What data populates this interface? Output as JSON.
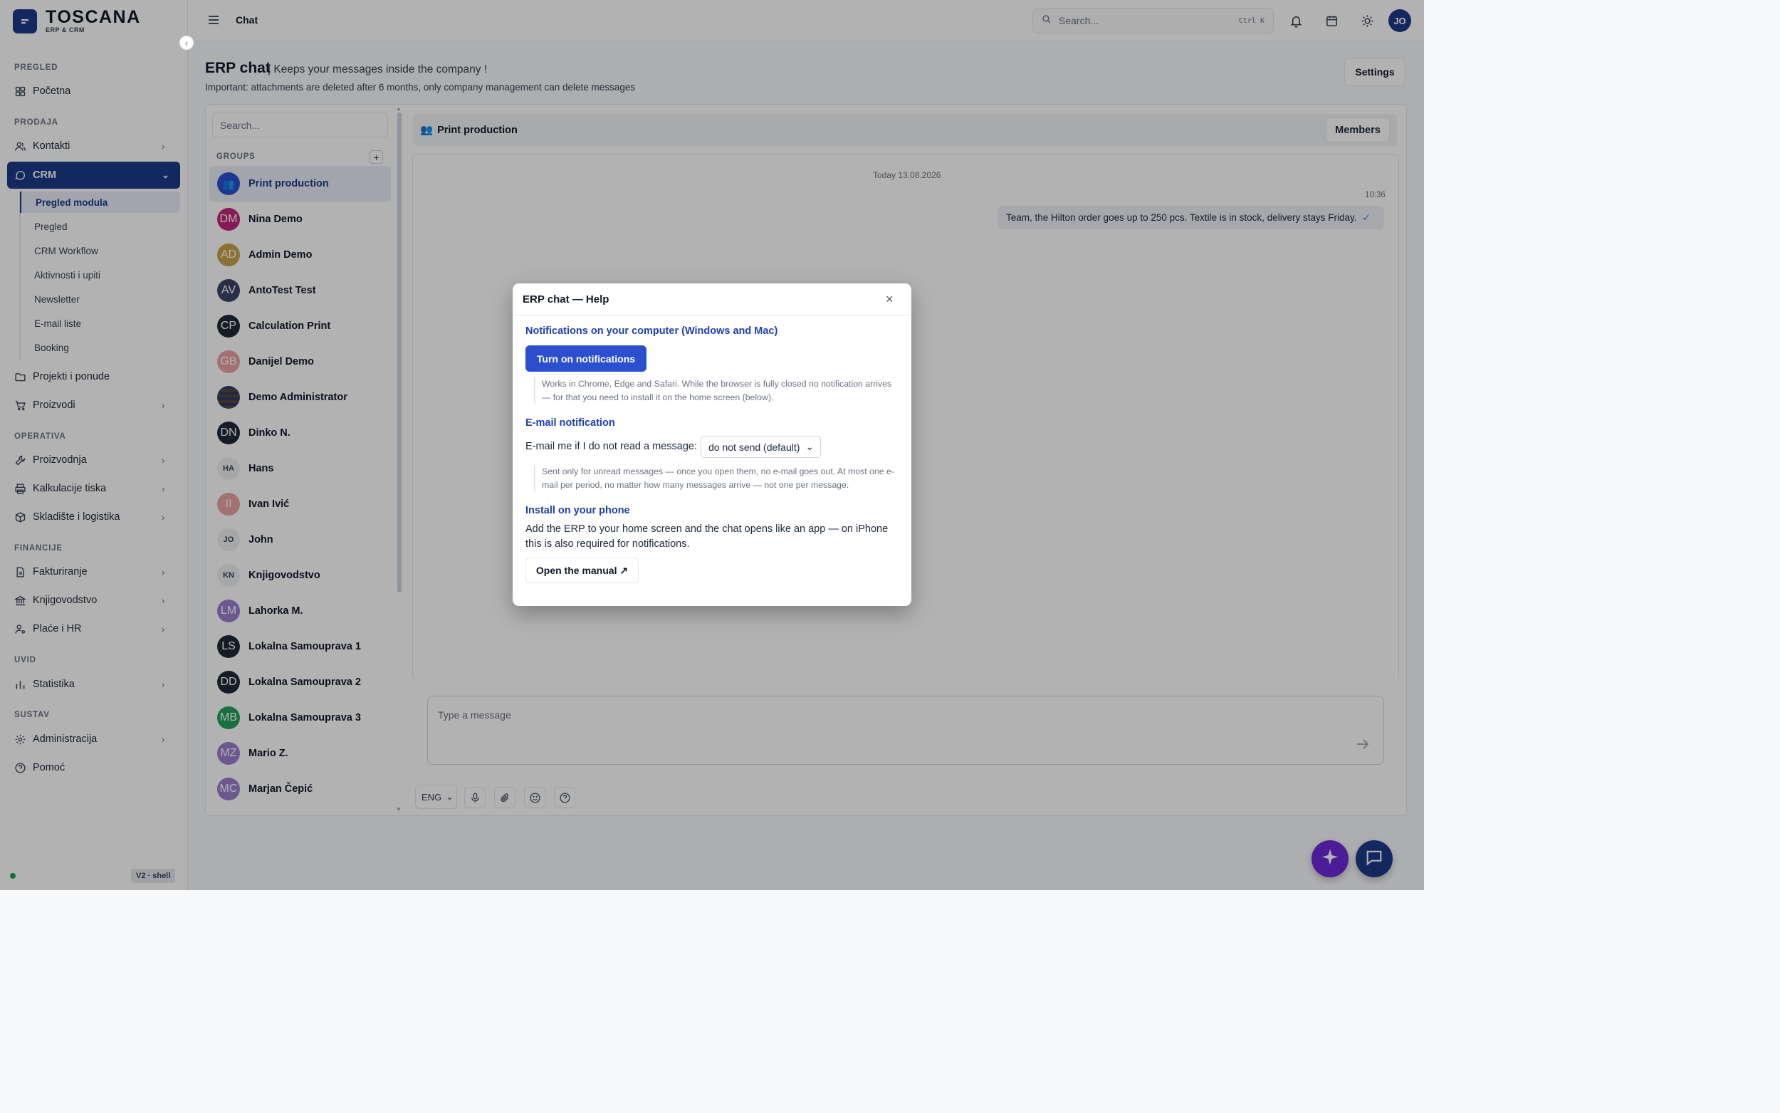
{
  "brand": {
    "name": "TOSCANA",
    "subtitle": "ERP & CRM"
  },
  "sidebar": {
    "sections": [
      "PREGLED",
      "PRODAJA",
      "OPERATIVA",
      "FINANCIJE",
      "UVID",
      "SUSTAV"
    ],
    "items": [
      {
        "label": "Početna"
      },
      {
        "label": "Kontakti"
      },
      {
        "label": "CRM"
      },
      {
        "label": "Projekti i ponude"
      },
      {
        "label": "Proizvodi"
      },
      {
        "label": "Proizvodnja"
      },
      {
        "label": "Kalkulacije tiska"
      },
      {
        "label": "Skladište i logistika"
      },
      {
        "label": "Fakturiranje"
      },
      {
        "label": "Knjigovodstvo"
      },
      {
        "label": "Plaće i HR"
      },
      {
        "label": "Statistika"
      },
      {
        "label": "Administracija"
      },
      {
        "label": "Pomoć"
      }
    ],
    "crm_sub": [
      "Pregled modula",
      "Pregled",
      "CRM Workflow",
      "Aktivnosti i upiti",
      "Newsletter",
      "E-mail liste",
      "Booking"
    ],
    "version": "V2 · shell"
  },
  "topbar": {
    "title": "Chat",
    "search_placeholder": "Search...",
    "search_shortcut": "Ctrl K",
    "avatar": "JO"
  },
  "page": {
    "title": "ERP chat",
    "tagline": "| Keeps your messages inside the company !",
    "note": "Important: attachments are deleted after 6 months, only company management can delete messages",
    "settings_label": "Settings"
  },
  "chat": {
    "search_placeholder": "Search...",
    "groups_label": "GROUPS",
    "add_label": "+",
    "contacts": [
      {
        "initials": "",
        "name": "Print production",
        "color": "#2b4fcf",
        "active": true
      },
      {
        "initials": "DM",
        "name": "Nina Demo",
        "color": "#c0267a"
      },
      {
        "initials": "AD",
        "name": "Admin Demo",
        "color": "#c9a24a"
      },
      {
        "initials": "AV",
        "name": "AntoTest Test",
        "color": "#3b4663"
      },
      {
        "initials": "CP",
        "name": "Calculation Print",
        "color": "#1f2937"
      },
      {
        "initials": "GB",
        "name": "Danijel Demo",
        "color": "#e8a3a3"
      },
      {
        "initials": "",
        "name": "Demo Administrator",
        "color": "#5b4636"
      },
      {
        "initials": "DN",
        "name": "Dinko N.",
        "color": "#1f2937"
      },
      {
        "initials": "HA",
        "name": "Hans",
        "color": "",
        "small": true
      },
      {
        "initials": "II",
        "name": "Ivan Ivić",
        "color": "#e8a3a3"
      },
      {
        "initials": "JO",
        "name": "John",
        "color": "",
        "small": true
      },
      {
        "initials": "KN",
        "name": "Knjigovodstvo",
        "color": "",
        "small": true
      },
      {
        "initials": "LM",
        "name": "Lahorka M.",
        "color": "#9b7fd0"
      },
      {
        "initials": "LS",
        "name": "Lokalna Samouprava 1",
        "color": "#1f2937"
      },
      {
        "initials": "DD",
        "name": "Lokalna Samouprava 2",
        "color": "#1f2937"
      },
      {
        "initials": "MB",
        "name": "Lokalna Samouprava 3",
        "color": "#22a35a"
      },
      {
        "initials": "MZ",
        "name": "Mario Z.",
        "color": "#9b7fd0"
      },
      {
        "initials": "MC",
        "name": "Marjan Čepić",
        "color": "#9b7fd0"
      }
    ],
    "active_group": "Print production",
    "members_label": "Members",
    "date_label": "Today 13.08.2026",
    "message_time": "10:36",
    "message_text": "Team, the Hilton order goes up to 250 pcs. Textile is in stock, delivery stays Friday.",
    "message_check": "✓",
    "composer_placeholder": "Type a message",
    "lang": "ENG"
  },
  "modal": {
    "title": "ERP chat — Help",
    "close": "×",
    "notif_heading": "Notifications on your computer (Windows and Mac)",
    "notif_button": "Turn on notifications",
    "notif_note": "Works in Chrome, Edge and Safari. While the browser is fully closed no notification arrives — for that you need to install it on the home screen (below).",
    "email_heading": "E-mail notification",
    "email_label": "E-mail me if I do not read a message:",
    "email_select": "do not send (default)",
    "email_note": "Sent only for unread messages — once you open them, no e-mail goes out. At most one e-mail per period, no matter how many messages arrive — not one per message.",
    "phone_heading": "Install on your phone",
    "phone_text": "Add the ERP to your home screen and the chat opens like an app — on iPhone this is also required for notifications.",
    "manual_button": "Open the manual ↗"
  },
  "colors": {
    "brand": "#1e3a8a",
    "accent": "#2b4fcf",
    "fab_ai": "#6d28d9"
  }
}
